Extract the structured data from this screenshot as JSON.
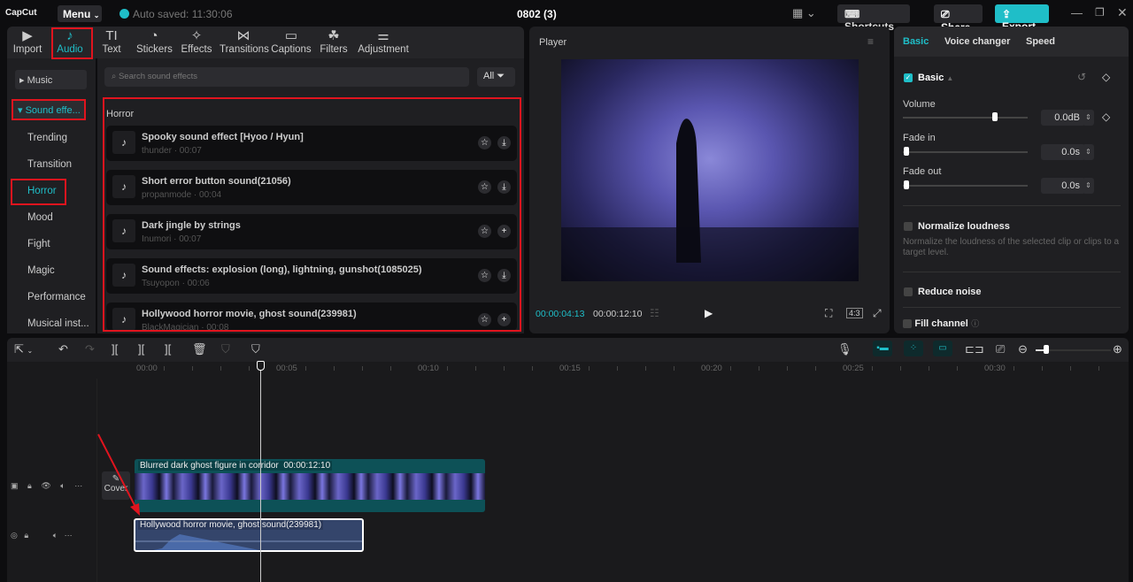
{
  "app": {
    "logo": "CapCut",
    "menu": "Menu",
    "autosave": "Auto saved: 11:30:06",
    "project_title": "0802 (3)",
    "shortcuts": "Shortcuts",
    "share": "Share",
    "export": "Export"
  },
  "toolbar_tabs": [
    {
      "label": "Import",
      "icon": "▶"
    },
    {
      "label": "Audio",
      "icon": "♪"
    },
    {
      "label": "Text",
      "icon": "TI"
    },
    {
      "label": "Stickers",
      "icon": "◔"
    },
    {
      "label": "Effects",
      "icon": "✧"
    },
    {
      "label": "Transitions",
      "icon": "⋈"
    },
    {
      "label": "Captions",
      "icon": "▭"
    },
    {
      "label": "Filters",
      "icon": "☘"
    },
    {
      "label": "Adjustment",
      "icon": "⚌"
    }
  ],
  "sidebar": {
    "music": "Music",
    "sound_effects": "Sound effe...",
    "items": [
      "Trending",
      "Transition",
      "Horror",
      "Mood",
      "Fight",
      "Magic",
      "Performance",
      "Musical inst..."
    ]
  },
  "search": {
    "placeholder": "Search sound effects",
    "filter": "All"
  },
  "section_title": "Horror",
  "sounds": [
    {
      "title": "Spooky sound effect [Hyoo / Hyun]",
      "meta": "thunder · 00:07",
      "action": "download"
    },
    {
      "title": "Short error button sound(21056)",
      "meta": "propanmode · 00:04",
      "action": "download"
    },
    {
      "title": "Dark jingle by strings",
      "meta": "Inumori · 00:07",
      "action": "add"
    },
    {
      "title": "Sound effects: explosion (long), lightning, gunshot(1085025)",
      "meta": "Tsuyopon · 00:06",
      "action": "download"
    },
    {
      "title": "Hollywood horror movie, ghost sound(239981)",
      "meta": "BlackMagician · 00:08",
      "action": "add"
    }
  ],
  "player": {
    "title": "Player",
    "current_time": "00:00:04:13",
    "total_time": "00:00:12:10",
    "ratio": "4:3"
  },
  "inspector": {
    "tabs": [
      "Basic",
      "Voice changer",
      "Speed"
    ],
    "section": "Basic",
    "volume_label": "Volume",
    "volume_value": "0.0dB",
    "volume_level": 0.75,
    "fade_in_label": "Fade in",
    "fade_in_value": "0.0s",
    "fade_out_label": "Fade out",
    "fade_out_value": "0.0s",
    "normalize": "Normalize loudness",
    "normalize_desc": "Normalize the loudness of the selected clip or clips to a target level.",
    "reduce_noise": "Reduce noise",
    "fill_channel": "Fill channel"
  },
  "timeline": {
    "ruler": [
      "00:00",
      "00:05",
      "00:10",
      "00:15",
      "00:20",
      "00:25",
      "00:30"
    ],
    "cover": "Cover",
    "video_clip": {
      "name": "Blurred dark ghost figure in corridor",
      "duration": "00:00:12:10"
    },
    "audio_clip": {
      "name": "Hollywood horror movie, ghost sound(239981)"
    }
  },
  "colors": {
    "accent": "#1fbec8",
    "annotation": "#e0141e"
  }
}
